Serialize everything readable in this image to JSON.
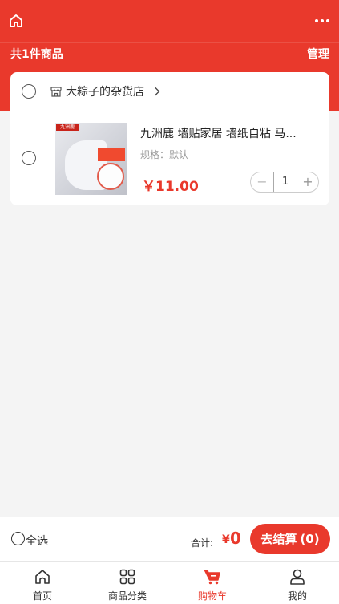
{
  "colors": {
    "accent": "#e9392c",
    "background": "#f4f4f4"
  },
  "header": {
    "left_icon": "home-icon",
    "right_icon": "more-dots-icon"
  },
  "summary": {
    "count_text": "共1件商品",
    "manage_label": "管理"
  },
  "store": {
    "name": "大粽子的杂货店",
    "icon": "store-icon"
  },
  "cart_items": [
    {
      "title": "九洲鹿 墙贴家居 墙纸自粘 马...",
      "spec": "规格：默认",
      "price": "￥11.00",
      "quantity": "1",
      "minus_label": "−",
      "plus_label": "+",
      "thumb_brand": "九洲鹿"
    }
  ],
  "checkout": {
    "select_all_label": "全选",
    "total_label": "合计:",
    "currency": "¥",
    "total_value": "0",
    "button_label": "去结算",
    "button_count": "(0)"
  },
  "tabbar": {
    "items": [
      {
        "label": "首页",
        "icon": "home-icon"
      },
      {
        "label": "商品分类",
        "icon": "category-grid-icon"
      },
      {
        "label": "购物车",
        "icon": "shopping-cart-icon",
        "active": true
      },
      {
        "label": "我的",
        "icon": "user-icon"
      }
    ]
  }
}
